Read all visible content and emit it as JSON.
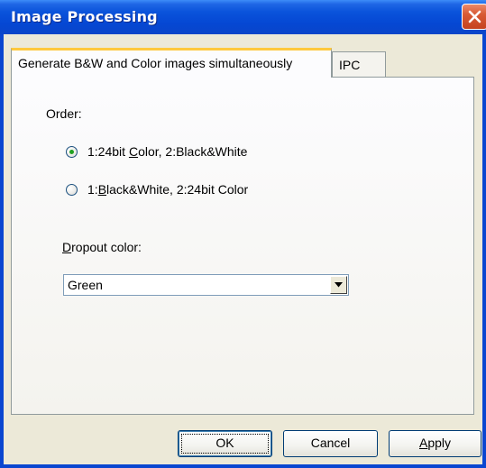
{
  "window": {
    "title": "Image Processing"
  },
  "tabs": [
    {
      "label": "Generate B&W and Color images simultaneously",
      "active": true
    },
    {
      "label": "IPC",
      "active": false
    }
  ],
  "order": {
    "label": "Order:",
    "options": [
      {
        "pre": "1:24bit ",
        "mnemonic": "C",
        "post": "olor, 2:Black&White",
        "selected": true
      },
      {
        "pre": "1:",
        "mnemonic": "B",
        "post": "lack&White, 2:24bit Color",
        "selected": false
      }
    ]
  },
  "dropout": {
    "label_mnemonic": "D",
    "label_rest": "ropout color:",
    "value": "Green"
  },
  "buttons": {
    "ok": "OK",
    "cancel": "Cancel",
    "apply_mnemonic": "A",
    "apply_rest": "pply"
  },
  "colors": {
    "titlebar": "#0a53db",
    "close": "#d85a35",
    "dialog_bg": "#ece9d8",
    "tab_highlight": "#ffc83c",
    "radio_dot": "#21a121"
  }
}
